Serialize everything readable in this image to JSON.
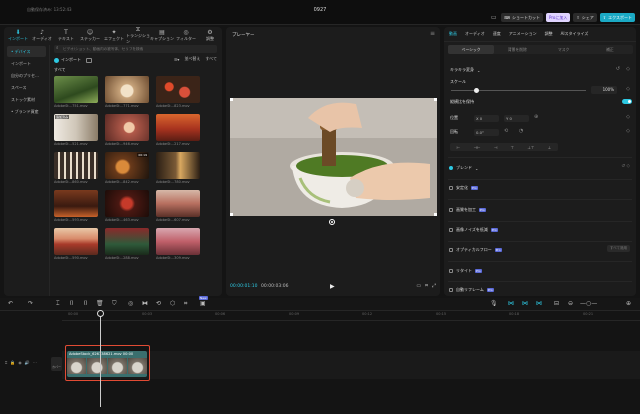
{
  "topbar": {
    "autosave": "自動保存済み: 13:52:43",
    "project_title": "0927",
    "shortcut_label": "ショートカット",
    "pro_label": "Proに加入",
    "share_label": "シェア",
    "export_label": "エクスポート"
  },
  "media": {
    "tabs": [
      {
        "label": "インポート",
        "icon": "import-icon"
      },
      {
        "label": "オーディオ",
        "icon": "audio-icon"
      },
      {
        "label": "テキスト",
        "icon": "text-icon"
      },
      {
        "label": "ステッカー",
        "icon": "sticker-icon"
      },
      {
        "label": "エフェクト",
        "icon": "effect-icon"
      },
      {
        "label": "トランジション",
        "icon": "transition-icon"
      },
      {
        "label": "キャプション",
        "icon": "caption-icon"
      },
      {
        "label": "フィルター",
        "icon": "filter-icon"
      },
      {
        "label": "調整",
        "icon": "adjust-icon"
      }
    ],
    "sidebar": [
      "• デバイス",
      "インポート",
      "自分のプリセ…",
      "スペース",
      "ストック素材",
      "• ブランド資産"
    ],
    "search_placeholder": "ビデオ/ショット、動画内の被写体、セリフを検索",
    "import_chip": "インポート",
    "sort_label": "並べ替え",
    "all_label": "すべて",
    "all_heading": "すべて",
    "items": [
      {
        "caption": "AdobeSt…751.mov",
        "duration": ""
      },
      {
        "caption": "AdobeSt…771.mov",
        "duration": ""
      },
      {
        "caption": "AdobeSt…823.mov",
        "duration": ""
      },
      {
        "caption": "AdobeSt…521.mov",
        "duration": "",
        "badge": "追加済み"
      },
      {
        "caption": "AdobeSt…946.mov",
        "duration": ""
      },
      {
        "caption": "AdobeSt…217.mov",
        "duration": ""
      },
      {
        "caption": "AdobeSt…860.mov",
        "duration": ""
      },
      {
        "caption": "AdobeSt…842.mov",
        "duration": "00:19"
      },
      {
        "caption": "AdobeSt…780.mov",
        "duration": ""
      },
      {
        "caption": "AdobeSt…593.mov",
        "duration": ""
      },
      {
        "caption": "AdobeSt…463.mov",
        "duration": ""
      },
      {
        "caption": "AdobeSt…607.mov",
        "duration": ""
      },
      {
        "caption": "AdobeSt…590.mov",
        "duration": ""
      },
      {
        "caption": "AdobeSt…288.mov",
        "duration": ""
      },
      {
        "caption": "AdobeSt…309.mov",
        "duration": ""
      }
    ]
  },
  "player": {
    "title": "プレーヤー",
    "current_time": "00:00:01:10",
    "total_time": "00:00:03:06"
  },
  "properties": {
    "tabs": [
      "動画",
      "オーディオ",
      "速度",
      "アニメーション",
      "調整",
      "AIスタイライズ"
    ],
    "subtabs": [
      "ベーシック",
      "背景を削除",
      "マスク",
      "補正"
    ],
    "transform_title": "キラキラ変身",
    "scale_label": "スケール",
    "scale_value": "100%",
    "ratio_label": "縦横比を保持",
    "position_label": "位置",
    "pos_x": "X 0",
    "pos_y": "Y 0",
    "rotate_label": "回転",
    "rotate_value": "0.0°",
    "blend_label": "ブレンド",
    "stabilize_label": "安定化",
    "enhance_label": "画質を加工",
    "denoise_label": "画像ノイズを低減",
    "optical_flow_label": "オプティカルフロー",
    "auto_remove_label": "すべて適用",
    "retouch_label": "リタイト",
    "auto_frame_label": "自動リフレーム",
    "pro_badge": "Pro"
  },
  "timeline": {
    "ruler": [
      "00:00",
      "00:03",
      "00:06",
      "00:09",
      "00:12",
      "00:15",
      "00:18",
      "00:21"
    ],
    "cover_label": "カバー",
    "clip_label": "AdobeStock_626738621.mov  00:00",
    "new_badge": "New"
  }
}
